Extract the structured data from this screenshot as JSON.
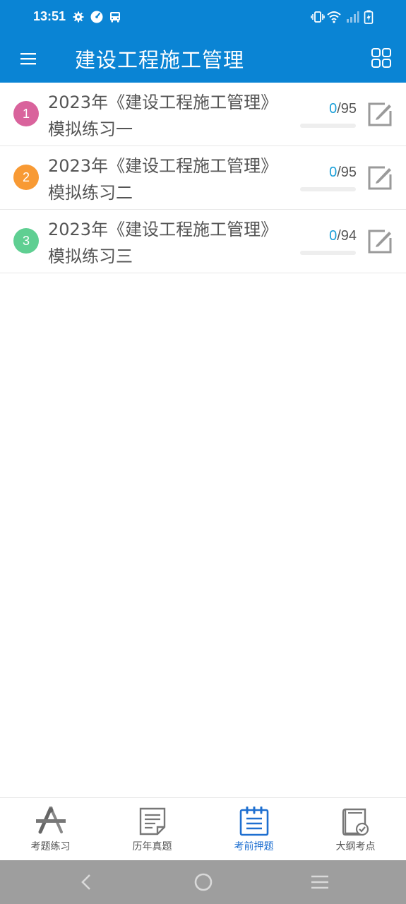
{
  "status_bar": {
    "time": "13:51",
    "left_icons": [
      "gear-icon",
      "speed-icon",
      "bus-icon"
    ],
    "right_icons": [
      "vibrate-icon",
      "wifi-icon",
      "signal-icon",
      "battery-charging-icon"
    ]
  },
  "app_bar": {
    "title": "建设工程施工管理",
    "menu_icon": "hamburger-menu-icon",
    "grid_icon": "grid-view-icon"
  },
  "colors": {
    "primary": "#0a84d4",
    "progress": "#1a9fd8",
    "tab_active": "#1e6fd0",
    "nav_bar": "#9e9e9e"
  },
  "list": {
    "items": [
      {
        "index": "1",
        "title": "2023年《建设工程施工管理》模拟练习一",
        "done": "0",
        "total": "/95",
        "progress_fraction": 0,
        "badge_color": "#d9639c"
      },
      {
        "index": "2",
        "title": "2023年《建设工程施工管理》模拟练习二",
        "done": "0",
        "total": "/95",
        "progress_fraction": 0,
        "badge_color": "#f89a34"
      },
      {
        "index": "3",
        "title": "2023年《建设工程施工管理》模拟练习三",
        "done": "0",
        "total": "/94",
        "progress_fraction": 0,
        "badge_color": "#5fcf92"
      }
    ]
  },
  "tabs": [
    {
      "label": "考题练习",
      "icon": "compass-tools-icon",
      "active": false
    },
    {
      "label": "历年真题",
      "icon": "document-icon",
      "active": false
    },
    {
      "label": "考前押题",
      "icon": "notebook-list-icon",
      "active": true
    },
    {
      "label": "大纲考点",
      "icon": "book-check-icon",
      "active": false
    }
  ],
  "nav_bar": {
    "icons": [
      "back-icon",
      "home-icon",
      "recents-icon"
    ]
  }
}
